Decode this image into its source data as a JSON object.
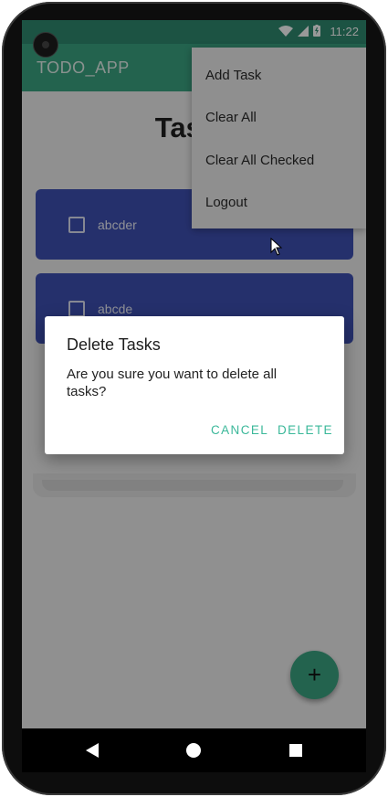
{
  "status_bar": {
    "time": "11:22",
    "icons": [
      "wifi-icon",
      "signal-icon",
      "battery-icon"
    ]
  },
  "app_bar": {
    "title": "TODO_APP",
    "overflow_icon": "more-vert-icon"
  },
  "page": {
    "heading": "Tasks"
  },
  "tasks": [
    {
      "label": "abcder",
      "checked": false
    },
    {
      "label": "abcde",
      "checked": false
    }
  ],
  "overflow_menu": {
    "items": [
      {
        "label": "Add Task"
      },
      {
        "label": "Clear All"
      },
      {
        "label": "Clear All Checked"
      },
      {
        "label": "Logout"
      }
    ]
  },
  "dialog": {
    "title": "Delete Tasks",
    "message": "Are you sure you want to delete all tasks?",
    "cancel_label": "CANCEL",
    "delete_label": "DELETE"
  },
  "fab": {
    "icon": "plus-icon"
  },
  "nav_bar": {
    "icons": [
      "back-icon",
      "home-icon",
      "recents-icon"
    ]
  },
  "colors": {
    "app_bar": "#3ba583",
    "task_card": "#3f51b5",
    "dialog_button": "#3bb89a"
  }
}
